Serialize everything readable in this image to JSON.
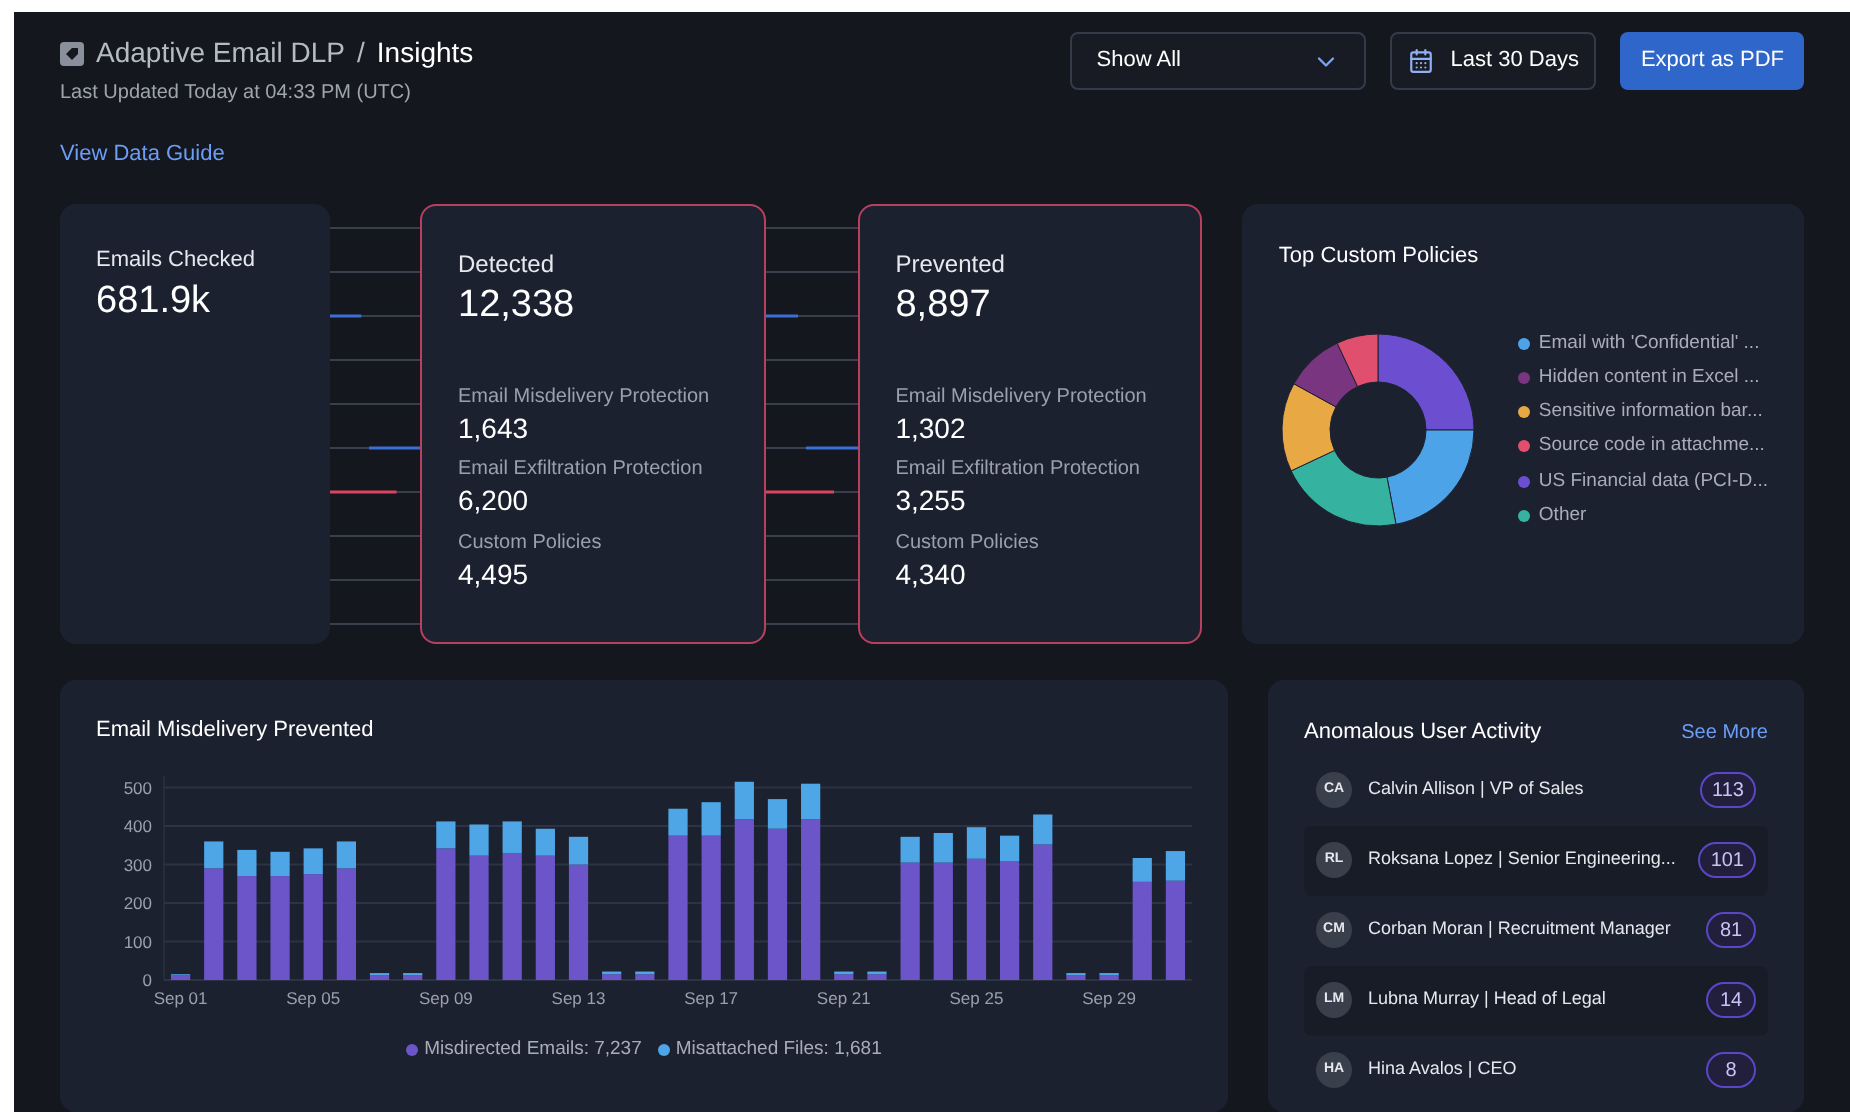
{
  "header": {
    "product": "Adaptive Email DLP",
    "separator": "/",
    "page": "Insights",
    "updated": "Last Updated Today at 04:33 PM (UTC)"
  },
  "filter": {
    "value": "Show All"
  },
  "date_range": {
    "label": "Last 30 Days"
  },
  "export_button": "Export as PDF",
  "guide_link": "View Data Guide",
  "emails_checked": {
    "label": "Emails Checked",
    "value": "681.9k"
  },
  "stat_cards": [
    {
      "label": "Detected",
      "value": "12,338",
      "items": [
        {
          "label": "Email Misdelivery Protection",
          "value": "1,643"
        },
        {
          "label": "Email Exfiltration Protection",
          "value": "6,200"
        },
        {
          "label": "Custom Policies",
          "value": "4,495"
        }
      ]
    },
    {
      "label": "Prevented",
      "value": "8,897",
      "items": [
        {
          "label": "Email Misdelivery Protection",
          "value": "1,302"
        },
        {
          "label": "Email Exfiltration Protection",
          "value": "3,255"
        },
        {
          "label": "Custom Policies",
          "value": "4,340"
        }
      ]
    }
  ],
  "top_policies": {
    "title": "Top Custom Policies",
    "legend": [
      {
        "label": "Email with 'Confidential' ...",
        "color": "#4da3e8"
      },
      {
        "label": "Hidden content in Excel ...",
        "color": "#7a3580"
      },
      {
        "label": "Sensitive information bar...",
        "color": "#e8a844"
      },
      {
        "label": "Source code in attachme...",
        "color": "#e0506e"
      },
      {
        "label": "US Financial data (PCI-D...",
        "color": "#6b4fd0"
      },
      {
        "label": "Other",
        "color": "#36b3a0"
      }
    ]
  },
  "misdelivery": {
    "title": "Email Misdelivery Prevented",
    "chart_data": {
      "type": "bar",
      "stacked": true,
      "categories": [
        "Sep 01",
        null,
        null,
        null,
        "Sep 05",
        null,
        null,
        null,
        "Sep 09",
        null,
        null,
        null,
        "Sep 13",
        null,
        null,
        null,
        "Sep 17",
        null,
        null,
        null,
        "Sep 21",
        null,
        null,
        null,
        "Sep 25",
        null,
        null,
        null,
        "Sep 29",
        null,
        null
      ],
      "yticks": [
        0,
        100,
        200,
        300,
        400,
        500
      ],
      "ylim": [
        0,
        530
      ],
      "grid": true,
      "series": [
        {
          "name": "Misdirected Emails: 7,237",
          "color": "#6b55c9",
          "values": [
            12,
            290,
            270,
            270,
            275,
            290,
            12,
            12,
            342,
            323,
            330,
            323,
            300,
            15,
            15,
            375,
            375,
            418,
            393,
            418,
            15,
            15,
            305,
            305,
            315,
            308,
            352,
            12,
            12,
            255,
            258
          ]
        },
        {
          "name": "Misattached Files: 1,681",
          "color": "#4ea6e6",
          "values": [
            3,
            70,
            68,
            63,
            67,
            70,
            6,
            6,
            70,
            81,
            82,
            70,
            72,
            7,
            7,
            70,
            87,
            97,
            77,
            92,
            7,
            7,
            67,
            77,
            82,
            67,
            78,
            6,
            6,
            62,
            77
          ]
        }
      ]
    }
  },
  "anomalous": {
    "title": "Anomalous User Activity",
    "see_more": "See More",
    "users": [
      {
        "initials": "CA",
        "name": "Calvin Allison | VP of Sales",
        "count": "113"
      },
      {
        "initials": "RL",
        "name": "Roksana Lopez | Senior Engineering...",
        "count": "101"
      },
      {
        "initials": "CM",
        "name": "Corban Moran | Recruitment Manager",
        "count": "81"
      },
      {
        "initials": "LM",
        "name": "Lubna Murray | Head of Legal",
        "count": "14"
      },
      {
        "initials": "HA",
        "name": "Hina Avalos | CEO",
        "count": "8"
      }
    ]
  }
}
